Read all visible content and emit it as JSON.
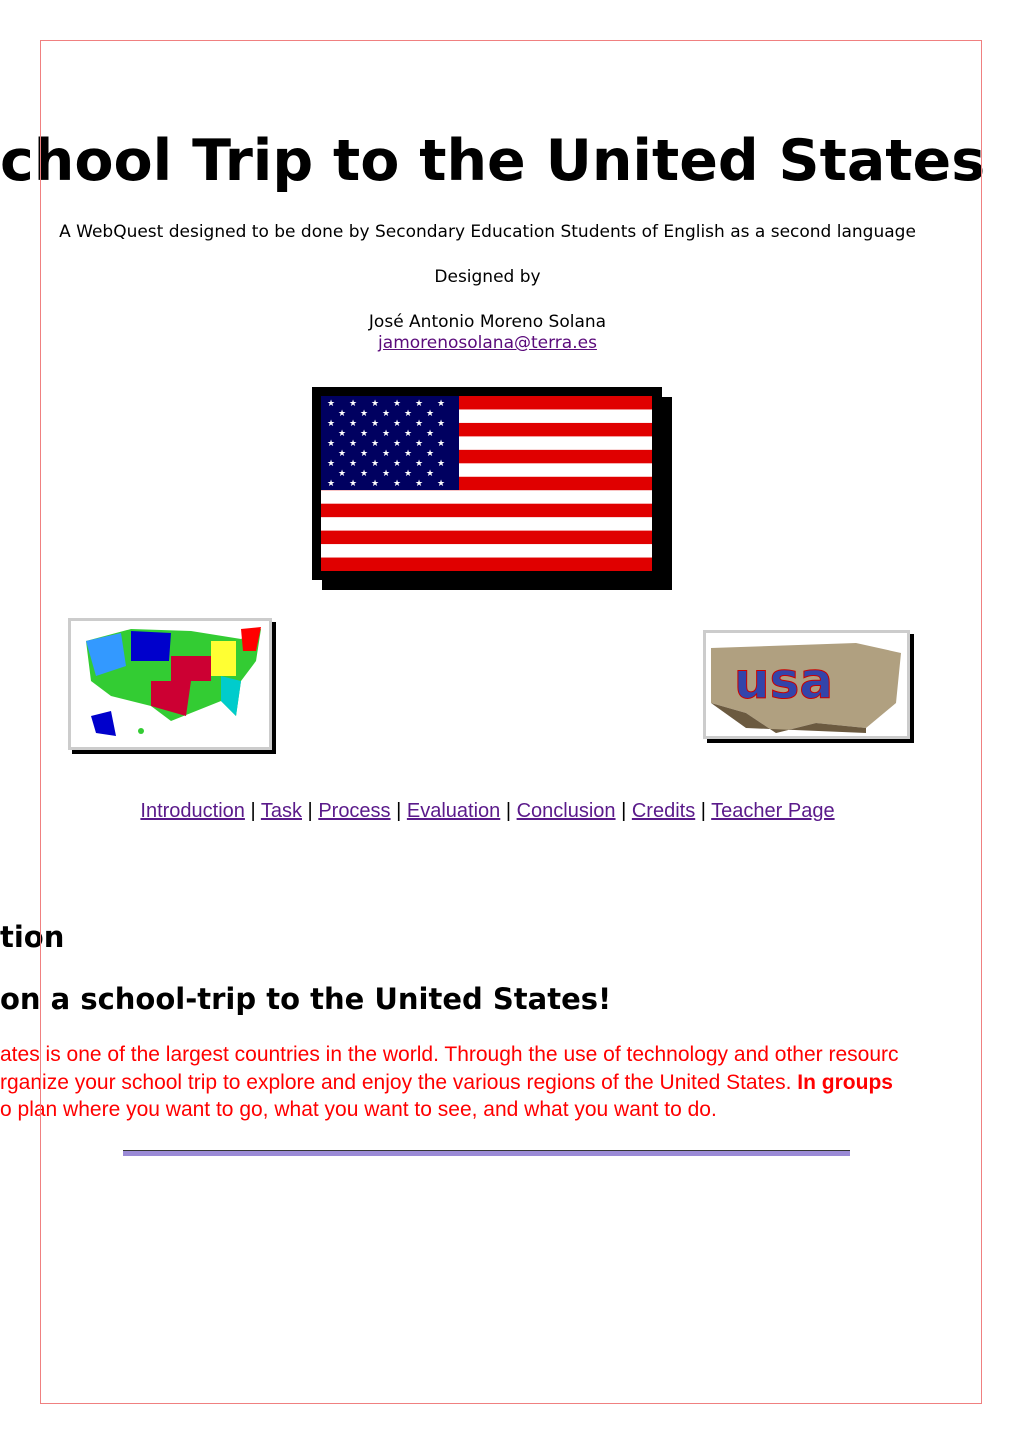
{
  "header": {
    "title": "chool Trip to the United States",
    "subtitle": "A WebQuest designed to be done by Secondary Education Students of English as a second language",
    "designed_by_label": "Designed by",
    "author": "José Antonio Moreno Solana",
    "email": "jamorenosolana@terra.es"
  },
  "images": {
    "flag": "usa-flag",
    "map": "usa-states-map",
    "logo": "usa-3d-text-map"
  },
  "nav": {
    "separator": "|",
    "links": [
      "Introduction",
      "Task",
      "Process",
      "Evaluation",
      "Conclusion",
      "Credits",
      "Teacher Page"
    ]
  },
  "introduction": {
    "heading": "tion",
    "subheading": "on a school-trip to the United States!",
    "lines": [
      "ates is one of the largest countries in the world. Through the use of technology and other resourc",
      "rganize your school trip to explore and enjoy the various regions of the United States. ",
      "o plan where you want to go, what you want to see, and what you want to do."
    ],
    "bold_text": "In groups"
  },
  "colors": {
    "body_text_red": "#ff0000",
    "link": "#5a1a8a",
    "rule": "#9a8ad6",
    "frame": "#f08080"
  }
}
